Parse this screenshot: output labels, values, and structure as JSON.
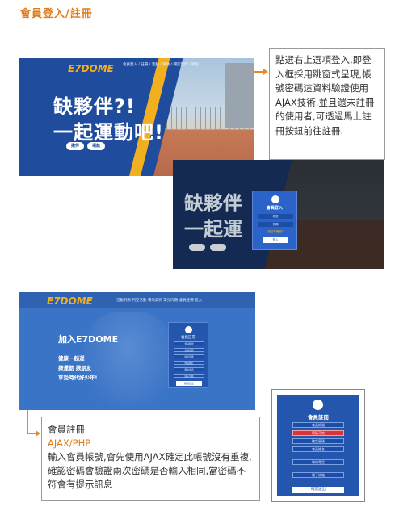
{
  "page": {
    "title": "會員登入/註冊"
  },
  "hero": {
    "logo": "E7DOME",
    "nav": "會員登入 / 註冊 / 活動 / 場地 / 關於我們 / 聯絡",
    "slogan_line1": "缺夥伴?!",
    "slogan_line2": "一起運動吧!",
    "button_join": "揪伴",
    "button_field": "場館"
  },
  "callout_login": {
    "text": "點選右上選項登入,即登入框採用跳窗式呈現,帳號密碼這資料驗證使用AJAX技術,並且還未註冊的使用者,可透過馬上註冊按鈕前往註冊."
  },
  "login_modal": {
    "slogan_line1": "缺夥伴",
    "slogan_line2": "一起運",
    "title": "會員登入",
    "account_field": "帳號",
    "password_field": "密碼",
    "register_link": "還沒有帳號?",
    "submit": "登入"
  },
  "register_page": {
    "logo": "E7DOME",
    "nav": "活動列表  刊登活動  場地資訊  常見問題  會員註冊  登入",
    "join_title": "加入E7DOME",
    "line1": "健康一起運",
    "line2": "揪運動 揪朋友",
    "line3": "享受時代好少年!",
    "form_title": "會員註冊",
    "fields": [
      "會員帳號",
      "會員密碼",
      "確認密碼",
      "會員姓名",
      "聯絡電話",
      "電子信箱"
    ],
    "submit": "確認送出"
  },
  "callout_register": {
    "heading": "會員註冊",
    "tech": "AJAX/PHP",
    "text": "輸入會員帳號,會先使用AJAX確定此帳號沒有重複,確認密碼會驗證兩次密碼是否輸入相同,當密碼不符會有提示訊息"
  },
  "mobile_form": {
    "title": "會員註冊",
    "fields": [
      "會員帳號",
      "密碼不符",
      "確認密碼",
      "會員姓名",
      "聯絡電話",
      "電子信箱"
    ],
    "submit": "確認送出"
  }
}
